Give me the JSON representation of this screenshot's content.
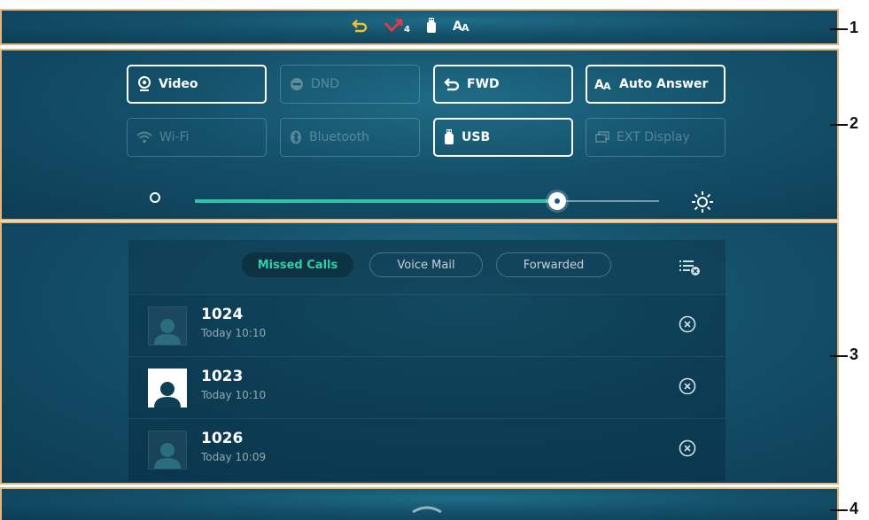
{
  "status_bar": {
    "icons": [
      "forward-icon",
      "missed-call-icon",
      "usb-icon",
      "auto-answer-icon"
    ],
    "missed_count": "4"
  },
  "quick_settings": {
    "buttons": [
      {
        "label": "Video",
        "icon": "camera-icon",
        "enabled": true
      },
      {
        "label": "DND",
        "icon": "dnd-icon",
        "enabled": false
      },
      {
        "label": "FWD",
        "icon": "forward-icon",
        "enabled": true
      },
      {
        "label": "Auto Answer",
        "icon": "auto-answer-icon",
        "enabled": true
      },
      {
        "label": "Wi-Fi",
        "icon": "wifi-icon",
        "enabled": false
      },
      {
        "label": "Bluetooth",
        "icon": "bluetooth-icon",
        "enabled": false
      },
      {
        "label": "USB",
        "icon": "usb-icon",
        "enabled": true
      },
      {
        "label": "EXT Display",
        "icon": "display-icon",
        "enabled": false
      }
    ],
    "brightness": 0.78
  },
  "notification_center": {
    "tabs": [
      {
        "label": "Missed Calls",
        "active": true
      },
      {
        "label": "Voice Mail",
        "active": false
      },
      {
        "label": "Forwarded",
        "active": false
      }
    ],
    "calls": [
      {
        "number": "1024",
        "time": "Today 10:10"
      },
      {
        "number": "1023",
        "time": "Today 10:10"
      },
      {
        "number": "1026",
        "time": "Today 10:09"
      }
    ]
  },
  "callouts": [
    "1",
    "2",
    "3",
    "4"
  ],
  "colors": {
    "accent": "#2fd0a9",
    "panel_border": "#e3b57f",
    "forward_yellow": "#f2c12e",
    "missed_red": "#e23a4a"
  }
}
